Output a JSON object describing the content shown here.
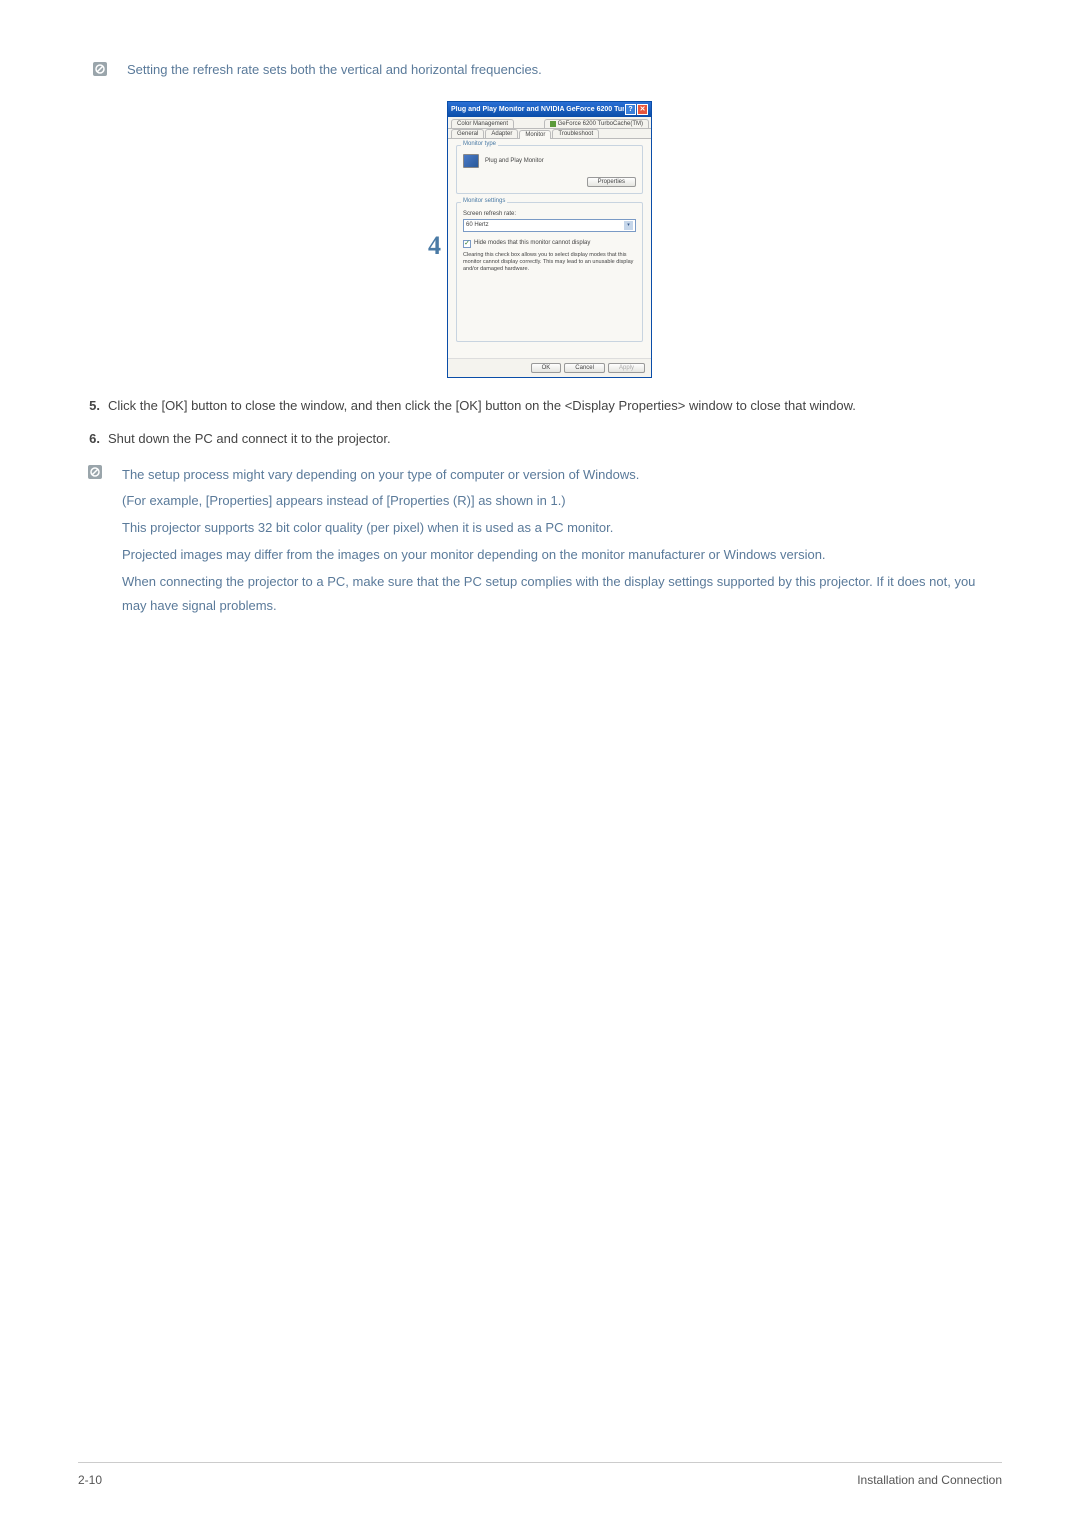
{
  "intro_note": "Setting the refresh rate sets both the vertical and horizontal frequencies.",
  "step_number": "4",
  "dialog": {
    "title": "Plug and Play Monitor and NVIDIA GeForce 6200 Tur...",
    "help_btn": "?",
    "close_btn": "✕",
    "tab_color": "Color Management",
    "tab_geforce": "GeForce 6200 TurboCache(TM)",
    "tab_general": "General",
    "tab_adapter": "Adapter",
    "tab_monitor": "Monitor",
    "tab_troubleshoot": "Troubleshoot",
    "monitor_type_legend": "Monitor type",
    "monitor_type_value": "Plug and Play Monitor",
    "properties_btn": "Properties",
    "monitor_settings_legend": "Monitor settings",
    "refresh_label": "Screen refresh rate:",
    "refresh_value": "60 Hertz",
    "hide_modes_checkbox": "Hide modes that this monitor cannot display",
    "hide_modes_help": "Clearing this check box allows you to select display modes that this monitor cannot display correctly. This may lead to an unusable display and/or damaged hardware.",
    "ok_btn": "OK",
    "cancel_btn": "Cancel",
    "apply_btn": "Apply"
  },
  "steps": {
    "5": {
      "num": "5.",
      "text": "Click the [OK] button to close the window, and then click the [OK] button on the <Display Properties> window to close that window."
    },
    "6": {
      "num": "6.",
      "text": "Shut down the PC and connect it to the projector."
    }
  },
  "notes": {
    "n1": "The setup process might vary depending on your type of computer or version of Windows.",
    "n2": "(For example, [Properties] appears instead of [Properties (R)] as shown in 1.)",
    "n3": "This projector supports 32 bit color quality (per pixel) when it is used as a PC monitor.",
    "n4": "Projected images may differ from the images on your monitor depending on the monitor manufacturer or Windows version.",
    "n5": "When connecting the projector to a PC, make sure that the PC setup complies with the display settings supported by this projector. If it does not, you may have signal problems."
  },
  "footer": {
    "page": "2-10",
    "section": "Installation and Connection"
  }
}
